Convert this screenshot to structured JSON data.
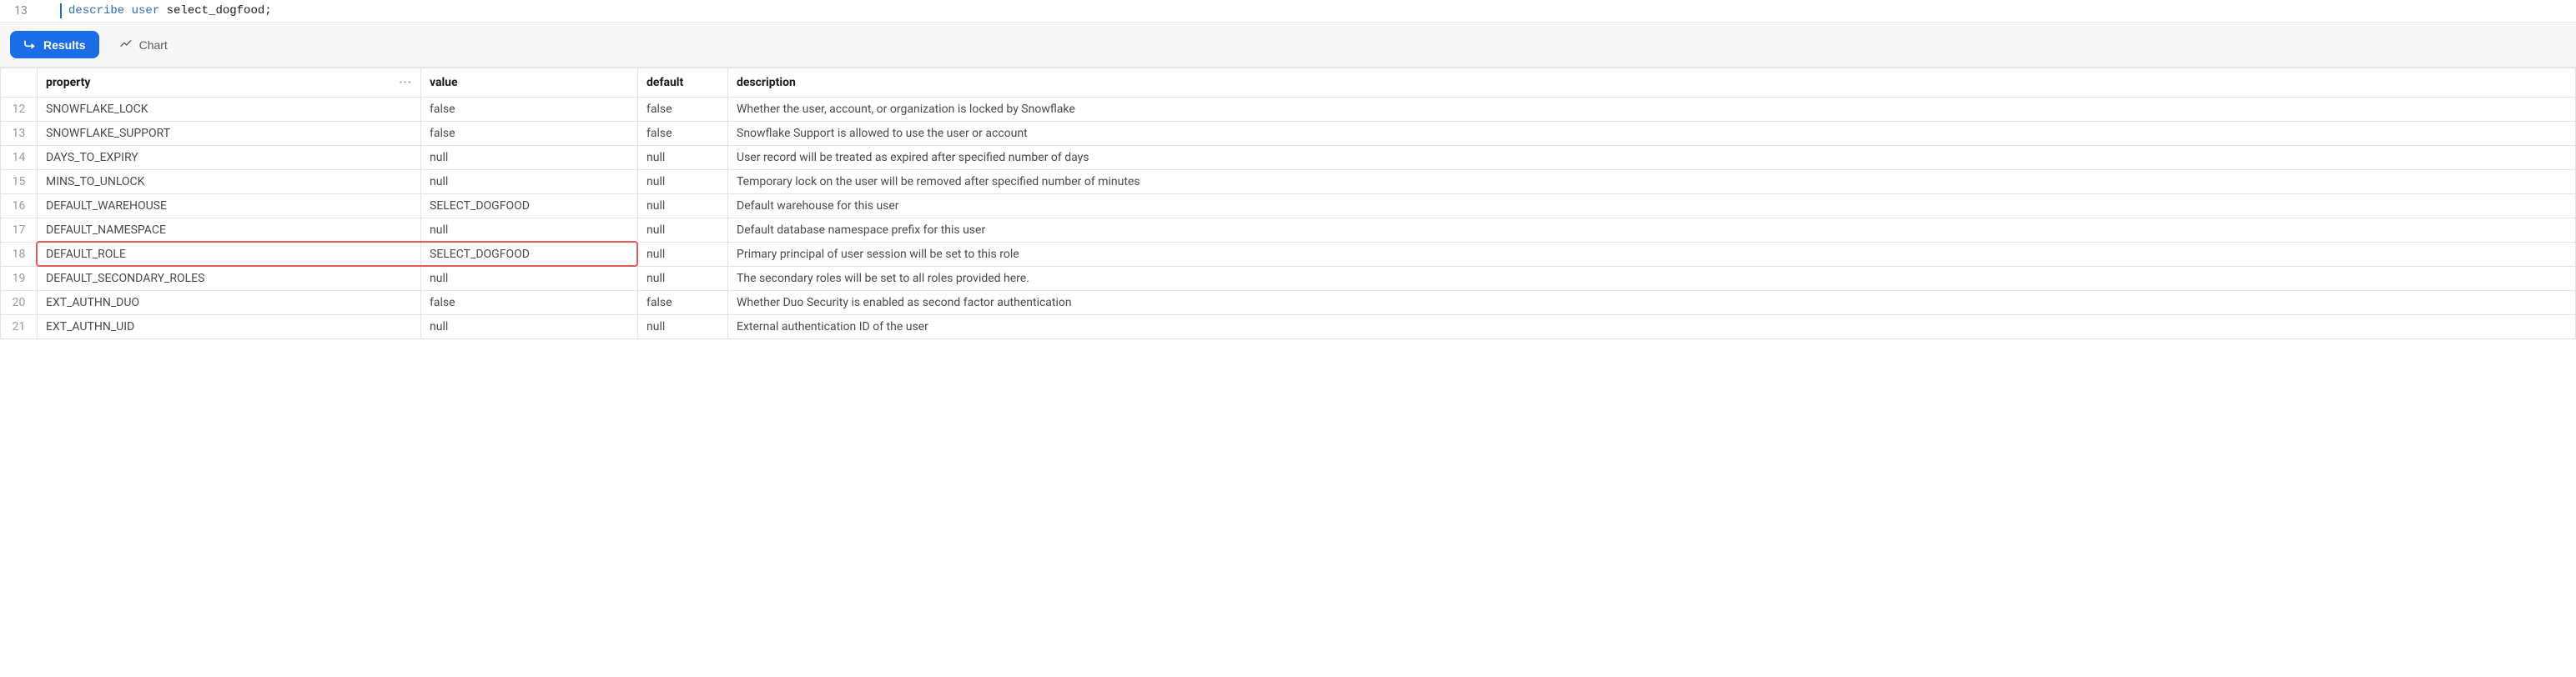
{
  "code": {
    "line_number": "13",
    "keyword_describe": "describe",
    "keyword_user": "user",
    "identifier": " select_dogfood;"
  },
  "toolbar": {
    "results_label": "Results",
    "chart_label": "Chart"
  },
  "table": {
    "headers": {
      "property": "property",
      "value": "value",
      "default": "default",
      "description": "description"
    },
    "menu_glyph": "···",
    "rows": [
      {
        "n": "12",
        "property": "SNOWFLAKE_LOCK",
        "value": "false",
        "default": "false",
        "description": "Whether the user, account, or organization is locked by Snowflake"
      },
      {
        "n": "13",
        "property": "SNOWFLAKE_SUPPORT",
        "value": "false",
        "default": "false",
        "description": "Snowflake Support is allowed to use the user or account"
      },
      {
        "n": "14",
        "property": "DAYS_TO_EXPIRY",
        "value": "null",
        "default": "null",
        "description": "User record will be treated as expired after specified number of days"
      },
      {
        "n": "15",
        "property": "MINS_TO_UNLOCK",
        "value": "null",
        "default": "null",
        "description": "Temporary lock on the user will be removed after specified number of minutes"
      },
      {
        "n": "16",
        "property": "DEFAULT_WAREHOUSE",
        "value": "SELECT_DOGFOOD",
        "default": "null",
        "description": "Default warehouse for this user"
      },
      {
        "n": "17",
        "property": "DEFAULT_NAMESPACE",
        "value": "null",
        "default": "null",
        "description": "Default database namespace prefix for this user"
      },
      {
        "n": "18",
        "property": "DEFAULT_ROLE",
        "value": "SELECT_DOGFOOD",
        "default": "null",
        "description": "Primary principal of user session will be set to this role"
      },
      {
        "n": "19",
        "property": "DEFAULT_SECONDARY_ROLES",
        "value": "null",
        "default": "null",
        "description": "The secondary roles will be set to all roles provided here."
      },
      {
        "n": "20",
        "property": "EXT_AUTHN_DUO",
        "value": "false",
        "default": "false",
        "description": "Whether Duo Security is enabled as second factor authentication"
      },
      {
        "n": "21",
        "property": "EXT_AUTHN_UID",
        "value": "null",
        "default": "null",
        "description": "External authentication ID of the user"
      }
    ],
    "highlighted_row_index": 6
  }
}
